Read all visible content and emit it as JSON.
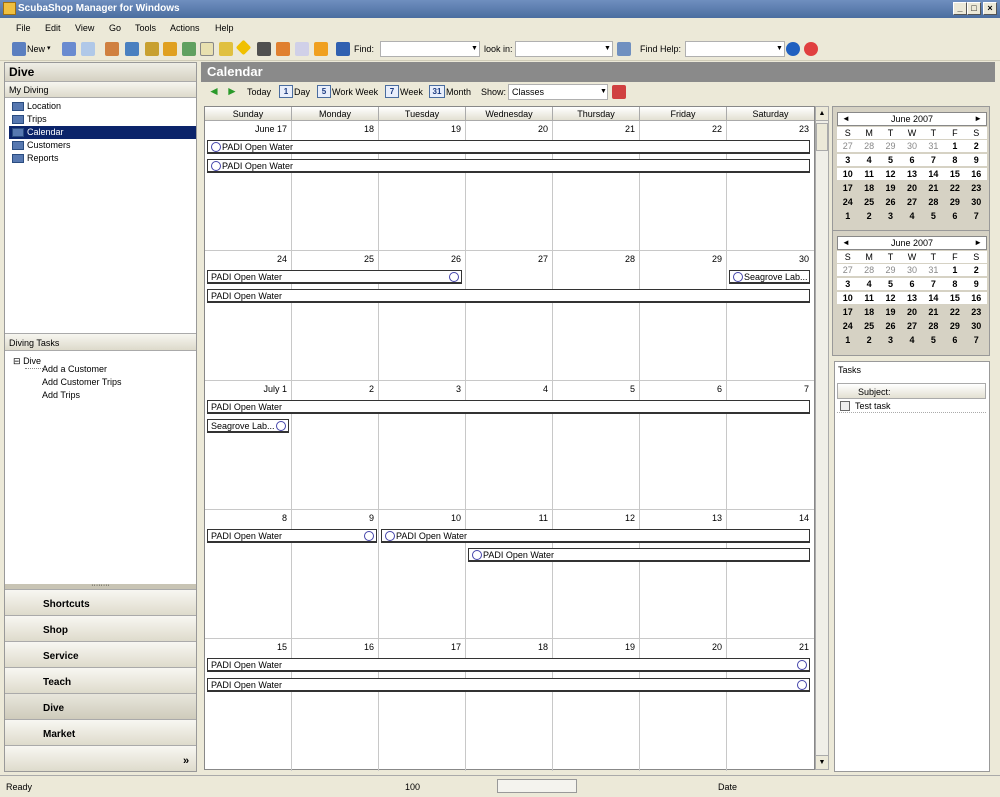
{
  "window": {
    "title": "ScubaShop Manager for Windows"
  },
  "menu": [
    "File",
    "Edit",
    "View",
    "Go",
    "Tools",
    "Actions",
    "Help"
  ],
  "toolbar": {
    "new_label": "New",
    "find_label": "Find:",
    "lookin_label": "look in:",
    "findhelp_label": "Find Help:"
  },
  "left": {
    "section_title": "Dive",
    "my_diving": "My Diving",
    "tree": [
      "Location",
      "Trips",
      "Calendar",
      "Customers",
      "Reports"
    ],
    "selected": "Calendar",
    "tasks_title": "Diving Tasks",
    "task_root": "Dive",
    "task_items": [
      "Add a Customer",
      "Add Customer Trips",
      "Add Trips"
    ],
    "nav": [
      "Shortcuts",
      "Shop",
      "Service",
      "Teach",
      "Dive",
      "Market"
    ],
    "active_nav": "Dive",
    "more": "»"
  },
  "calendar": {
    "title": "Calendar",
    "today": "Today",
    "day": "Day",
    "work_week": "Work Week",
    "week": "Week",
    "month": "Month",
    "show_label": "Show:",
    "show_value": "Classes",
    "days": [
      "Sunday",
      "Monday",
      "Tuesday",
      "Wednesday",
      "Thursday",
      "Friday",
      "Saturday"
    ],
    "weeks": [
      [
        "June 17",
        "18",
        "19",
        "20",
        "21",
        "22",
        "23"
      ],
      [
        "24",
        "25",
        "26",
        "27",
        "28",
        "29",
        "30"
      ],
      [
        "July 1",
        "2",
        "3",
        "4",
        "5",
        "6",
        "7"
      ],
      [
        "8",
        "9",
        "10",
        "11",
        "12",
        "13",
        "14"
      ],
      [
        "15",
        "16",
        "17",
        "18",
        "19",
        "20",
        "21"
      ]
    ],
    "events": {
      "e1": "PADI Open Water",
      "e2": "PADI Open Water",
      "e3": "PADI Open Water",
      "e4": "Seagrove Lab...",
      "e5": "PADI Open Water",
      "e6": "PADI Open Water",
      "e7": "Seagrove Lab...",
      "e8": "PADI Open Water",
      "e9": "PADI Open Water",
      "e10": "PADI Open Water",
      "e11": "PADI Open Water",
      "e12": "PADI Open Water"
    }
  },
  "minical": {
    "month": "June 2007",
    "dow": [
      "S",
      "M",
      "T",
      "W",
      "T",
      "F",
      "S"
    ],
    "rows": [
      [
        "27",
        "28",
        "29",
        "30",
        "31",
        "1",
        "2"
      ],
      [
        "3",
        "4",
        "5",
        "6",
        "7",
        "8",
        "9"
      ],
      [
        "10",
        "11",
        "12",
        "13",
        "14",
        "15",
        "16"
      ],
      [
        "17",
        "18",
        "19",
        "20",
        "21",
        "22",
        "23"
      ],
      [
        "24",
        "25",
        "26",
        "27",
        "28",
        "29",
        "30"
      ],
      [
        "1",
        "2",
        "3",
        "4",
        "5",
        "6",
        "7"
      ]
    ]
  },
  "tasks": {
    "title": "Tasks",
    "subject": "Subject:",
    "items": [
      "Test task"
    ]
  },
  "status": {
    "left": "Ready",
    "mid": "100",
    "right": "Date"
  },
  "glyphs": {
    "close": "×",
    "left_arrow": "◄",
    "right_arrow": "►",
    "day_num": "1",
    "ww_num": "5",
    "week_num": "7",
    "month_num": "31",
    "tree_toggle": "⊟",
    "scroll_up": "▲",
    "scroll_down": "▼"
  }
}
